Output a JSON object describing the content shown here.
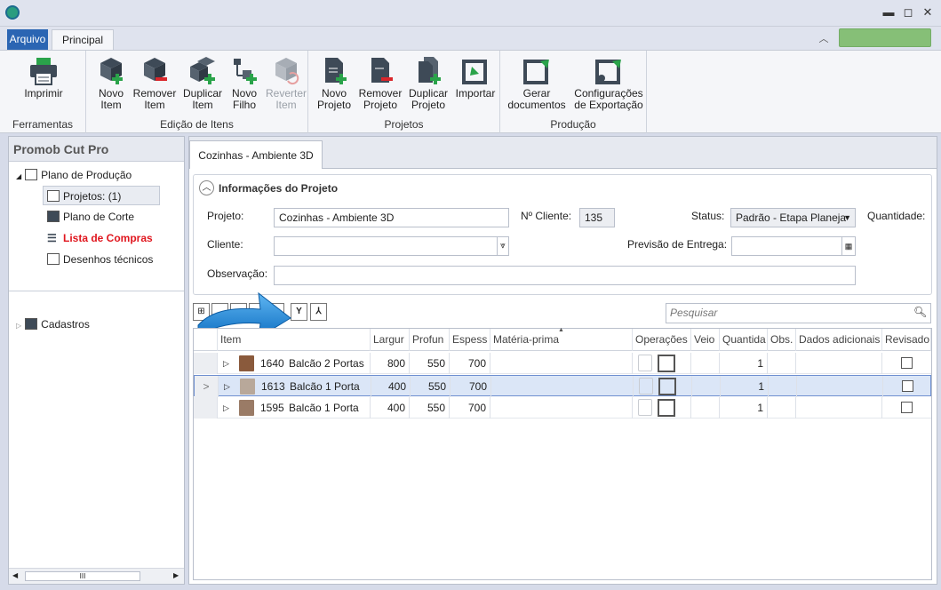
{
  "window": {
    "minimize": "▬",
    "restore": "◻",
    "close": "✕"
  },
  "ribbon_tabs": {
    "file": "Arquivo",
    "main": "Principal"
  },
  "ribbon": {
    "groups": [
      {
        "label": "Ferramentas",
        "buttons": [
          {
            "label1": "Imprimir",
            "label2": "",
            "icon": "printer-icon"
          }
        ]
      },
      {
        "label": "Edição de Itens",
        "buttons": [
          {
            "label1": "Novo",
            "label2": "Item",
            "icon": "new-item-icon"
          },
          {
            "label1": "Remover",
            "label2": "Item",
            "icon": "remove-item-icon"
          },
          {
            "label1": "Duplicar",
            "label2": "Item",
            "icon": "duplicate-item-icon"
          },
          {
            "label1": "Novo",
            "label2": "Filho",
            "icon": "new-child-icon"
          },
          {
            "label1": "Reverter",
            "label2": "Item",
            "icon": "revert-item-icon"
          }
        ]
      },
      {
        "label": "Projetos",
        "buttons": [
          {
            "label1": "Novo",
            "label2": "Projeto",
            "icon": "new-project-icon"
          },
          {
            "label1": "Remover",
            "label2": "Projeto",
            "icon": "remove-project-icon"
          },
          {
            "label1": "Duplicar",
            "label2": "Projeto",
            "icon": "duplicate-project-icon"
          },
          {
            "label1": "Importar",
            "label2": "",
            "icon": "import-icon"
          }
        ]
      },
      {
        "label": "Produção",
        "buttons": [
          {
            "label1": "Gerar",
            "label2": "documentos",
            "icon": "generate-docs-icon"
          },
          {
            "label1": "Configurações",
            "label2": "de Exportação",
            "icon": "export-settings-icon"
          }
        ]
      }
    ]
  },
  "sidebar": {
    "title": "Promob Cut Pro",
    "items": [
      {
        "label": "Plano de Produção"
      },
      {
        "label": "Projetos: (1)"
      },
      {
        "label": "Plano de Corte"
      },
      {
        "label": "Lista de Compras"
      },
      {
        "label": "Desenhos técnicos"
      },
      {
        "label": "Cadastros"
      }
    ],
    "scroll_thumb": "III"
  },
  "doc_tab": "Cozinhas - Ambiente 3D",
  "project_info": {
    "title": "Informações do Projeto",
    "project_label": "Projeto:",
    "project_value": "Cozinhas - Ambiente 3D",
    "client_no_label": "Nº Cliente:",
    "client_no_value": "135",
    "status_label": "Status:",
    "status_value": "Padrão - Etapa Planeja",
    "quantity_label": "Quantidade:",
    "client_label": "Cliente:",
    "client_value": "",
    "delivery_label": "Previsão de Entrega:",
    "delivery_value": "",
    "obs_label": "Observação:",
    "obs_value": ""
  },
  "search": {
    "placeholder": "Pesquisar"
  },
  "grid": {
    "columns": [
      "Item",
      "Largura",
      "Profundidade",
      "Espessura",
      "Matéria-prima",
      "Operações",
      "Veio",
      "Quantidade",
      "Obs.",
      "Dados adicionais",
      "Revisado"
    ],
    "column_display": [
      "Item",
      "Largur",
      "Profun",
      "Espess",
      "Matéria-prima",
      "Operações",
      "Veio",
      "Quantida",
      "Obs.",
      "Dados adicionais",
      "Revisado"
    ],
    "rows": [
      {
        "id": "1640",
        "name": "Balcão 2 Portas",
        "largura": "800",
        "profundidade": "550",
        "espessura": "700",
        "quantidade": "1",
        "selected": false,
        "color": "#8a5a3c"
      },
      {
        "id": "1613",
        "name": "Balcão 1 Porta",
        "largura": "400",
        "profundidade": "550",
        "espessura": "700",
        "quantidade": "1",
        "selected": true,
        "color": "#b8a89a"
      },
      {
        "id": "1595",
        "name": "Balcão 1 Porta",
        "largura": "400",
        "profundidade": "550",
        "espessura": "700",
        "quantidade": "1",
        "selected": false,
        "color": "#9a7b66"
      }
    ]
  },
  "colors": {
    "accent": "#2b65b3",
    "green": "#86bf77",
    "red_link": "#e0161e",
    "arrow": "#1a86d6"
  }
}
